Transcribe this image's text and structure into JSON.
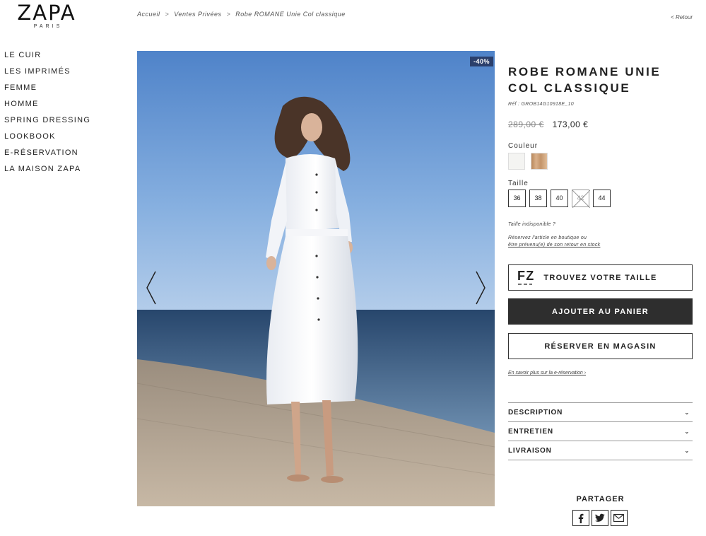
{
  "brand": {
    "name": "ZAPA",
    "subtitle": "PARIS"
  },
  "breadcrumb": [
    "Accueil",
    "Ventes Privées",
    "Robe ROMANE Unie Col classique"
  ],
  "breadcrumb_separator": ">",
  "back_label": "< Retour",
  "nav": [
    "LE CUIR",
    "LES IMPRIMÉS",
    "FEMME",
    "HOMME",
    "SPRING DRESSING",
    "LOOKBOOK",
    "E-RÉSERVATION",
    "LA MAISON ZAPA"
  ],
  "image": {
    "discount_badge": "-40%"
  },
  "product": {
    "title": "ROBE ROMANE UNIE COL CLASSIQUE",
    "ref": "Réf : GROB14G10918E_10",
    "old_price": "289,00 €",
    "price": "173,00 €",
    "color_label": "Couleur",
    "colors": [
      "#f4f4f2",
      "#c99a6a"
    ],
    "size_label": "Taille",
    "sizes": [
      {
        "label": "36",
        "available": true
      },
      {
        "label": "38",
        "available": true
      },
      {
        "label": "40",
        "available": true
      },
      {
        "label": "42",
        "available": false
      },
      {
        "label": "44",
        "available": true
      }
    ],
    "size_unavailable_note": "Taille indisponible ?",
    "reserve_note_line1": "Réservez l'article en boutique ou",
    "reserve_note_link": "être prévenu(e) de son retour en stock"
  },
  "buttons": {
    "find_size": "TROUVEZ VOTRE TAILLE",
    "add_to_cart": "AJOUTER AU PANIER",
    "reserve": "RÉSERVER EN MAGASIN"
  },
  "learn_more": "En savoir plus sur la e-réservation ›",
  "accordion": [
    "DESCRIPTION",
    "ENTRETIEN",
    "LIVRAISON"
  ],
  "share": {
    "title": "PARTAGER",
    "icons": [
      "facebook-icon",
      "twitter-icon",
      "email-icon"
    ]
  }
}
